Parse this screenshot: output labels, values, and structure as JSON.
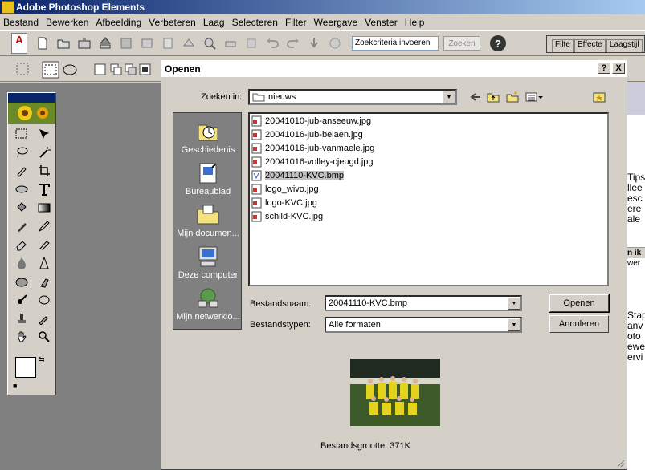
{
  "app": {
    "title": "Adobe Photoshop Elements"
  },
  "menu": [
    "Bestand",
    "Bewerken",
    "Afbeelding",
    "Verbeteren",
    "Laag",
    "Selecteren",
    "Filter",
    "Weergave",
    "Venster",
    "Help"
  ],
  "toolbar": {
    "search_value": "Zoekcriteria invoeren",
    "search_button": "Zoeken",
    "help": "?",
    "adobe": "A",
    "adobe_sub": "Adobe"
  },
  "palette_well": [
    "Filte",
    "Effecte",
    "Laagstijl"
  ],
  "right_doc_text": [
    "Tips",
    "llee",
    "esc",
    "ere",
    "ale"
  ],
  "right_doc_text2": [
    "n ik",
    "wer"
  ],
  "right_doc_text3": [
    "Stap",
    "anv",
    "oto",
    "ewe",
    "ervi"
  ],
  "dialog": {
    "title": "Openen",
    "help_btn": "?",
    "close_btn": "X",
    "look_in_label": "Zoeken in:",
    "look_in_value": "nieuws",
    "places": [
      "Geschiedenis",
      "Bureaublad",
      "Mijn documen...",
      "Deze computer",
      "Mijn netwerklo..."
    ],
    "files": [
      "20041010-jub-anseeuw.jpg",
      "20041016-jub-belaen.jpg",
      "20041016-jub-vanmaele.jpg",
      "20041016-volley-cjeugd.jpg",
      "20041110-KVC.bmp",
      "logo_wivo.jpg",
      "logo-KVC.jpg",
      "schild-KVC.jpg"
    ],
    "selected_index": 4,
    "filename_label": "Bestandsnaam:",
    "filename_value": "20041110-KVC.bmp",
    "filetype_label": "Bestandstypen:",
    "filetype_value": "Alle formaten",
    "open_button": "Openen",
    "cancel_button": "Annuleren",
    "file_size_label": "Bestandsgrootte: 371K"
  },
  "colors": {
    "titlebar": "#0a246a",
    "selection": "#c0c0c0",
    "places_bg": "#808080",
    "workspace": "#808080"
  }
}
